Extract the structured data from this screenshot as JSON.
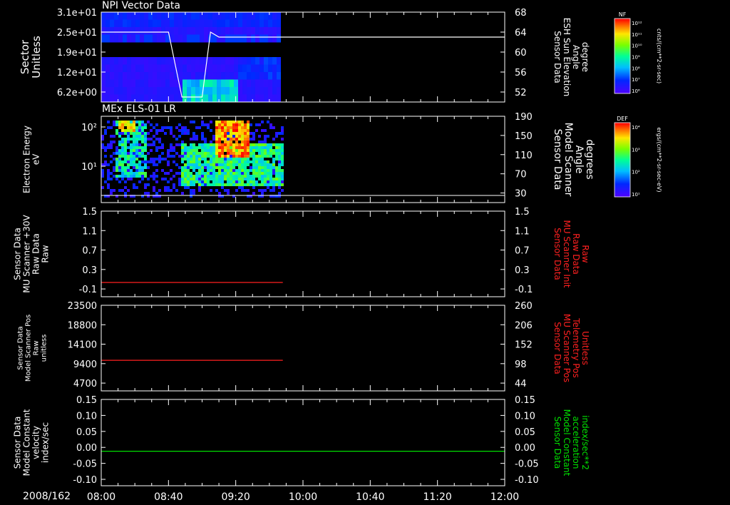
{
  "date_label": "2008/162",
  "time_ticks": [
    "08:00",
    "08:40",
    "09:20",
    "10:00",
    "10:40",
    "11:20",
    "12:00"
  ],
  "colors": {
    "red": "#ff2020",
    "green": "#00e000",
    "white": "#ffffff"
  },
  "chart_data": [
    {
      "type": "heatmap",
      "title": "NPI Vector Data",
      "left_axis": {
        "label_lines": [
          "Sector",
          "Unitless"
        ],
        "ticks": [
          "3.1e+01",
          "2.5e+01",
          "1.9e+01",
          "1.2e+01",
          "6.2e+00"
        ],
        "color": "#ffffff"
      },
      "right_axis": {
        "label_lines": [
          "Sensor Data",
          "ESH Sun Elevation",
          "Angle",
          "degree"
        ],
        "ticks": [
          "68",
          "64",
          "60",
          "56",
          "52"
        ],
        "color": "#ffffff"
      },
      "colorbar": {
        "title": "NF",
        "ticks": [
          "10¹²",
          "10¹¹",
          "10¹⁰",
          "10⁹",
          "10⁸",
          "10⁷",
          "10⁶"
        ],
        "label": "cnts/(cm**2-sr-sec)"
      },
      "data_extent": {
        "start": "08:00",
        "end": "09:45"
      },
      "line_series": {
        "name": "ESH Sun Elevation",
        "x": [
          "08:00",
          "08:40",
          "08:48",
          "09:00",
          "09:05",
          "09:10",
          "09:45",
          "12:00"
        ],
        "y": [
          64,
          64,
          51,
          51,
          64,
          63,
          63,
          63
        ]
      }
    },
    {
      "type": "heatmap",
      "title": "MEx ELS-01 LR",
      "left_axis": {
        "label_lines": [
          "Electron Energy",
          "eV"
        ],
        "ticks": [
          "10²",
          "10¹"
        ],
        "scale": "log",
        "color": "#ffffff"
      },
      "right_axis": {
        "label_lines": [
          "Sensor Data",
          "Model Scanner",
          "Angle",
          "degrees"
        ],
        "ticks": [
          "190",
          "150",
          "110",
          "70",
          "30"
        ],
        "color": "#ffffff"
      },
      "colorbar": {
        "title": "DEF",
        "ticks": [
          "10⁴",
          "10³",
          "10²",
          "10¹"
        ],
        "label": "ergs/(cm**2-sr-sec-eV)"
      },
      "data_extent": {
        "start": "08:00",
        "end": "09:47"
      },
      "line_series": {
        "name": "Model Scanner Angle",
        "value": 15
      }
    },
    {
      "type": "line",
      "left_axis": {
        "label_lines": [
          "Sensor Data",
          "MU Scanner +30V",
          "Raw Data",
          "Raw"
        ],
        "ticks": [
          "1.5",
          "1.1",
          "0.7",
          "0.3",
          "-0.1"
        ],
        "ylim": [
          -0.3,
          1.5
        ],
        "color": "#ffffff"
      },
      "right_axis": {
        "label_lines": [
          "Sensor Data",
          "MU Scanner Init",
          "Raw Data",
          "Raw"
        ],
        "ticks": [
          "1.5",
          "1.1",
          "0.7",
          "0.3",
          "-0.1"
        ],
        "color": "#ff2020"
      },
      "series": [
        {
          "x": [
            "08:00",
            "09:48"
          ],
          "y": [
            0,
            0
          ],
          "color": "#ff2020"
        }
      ]
    },
    {
      "type": "line",
      "left_axis": {
        "label_lines": [
          "Sensor Data",
          "Model Scanner Pos",
          "Raw",
          "unitless"
        ],
        "ticks": [
          "23500",
          "18800",
          "14100",
          "9400",
          "4700"
        ],
        "ylim": [
          0,
          23500
        ],
        "color": "#ffffff"
      },
      "right_axis": {
        "label_lines": [
          "Sensor Data",
          "MU Scanner Pos",
          "Telemetry Pos",
          "Unitless"
        ],
        "ticks": [
          "260",
          "206",
          "152",
          "98",
          "44"
        ],
        "color": "#ff2020"
      },
      "series": [
        {
          "x": [
            "08:00",
            "09:48"
          ],
          "y": [
            8400,
            8400
          ],
          "color": "#ff2020"
        }
      ]
    },
    {
      "type": "line",
      "left_axis": {
        "label_lines": [
          "Sensor Data",
          "Model Constant",
          "velocity",
          "index/sec"
        ],
        "ticks": [
          "0.15",
          "0.10",
          "0.05",
          "0.00",
          "-0.05",
          "-0.10"
        ],
        "ylim": [
          -0.1,
          0.15
        ],
        "color": "#ffffff"
      },
      "right_axis": {
        "label_lines": [
          "Sensor Data",
          "Model Constant",
          "acceleration",
          "index/sec**2"
        ],
        "ticks": [
          "0.15",
          "0.10",
          "0.05",
          "0.00",
          "-0.05",
          "-0.10"
        ],
        "color": "#00e000"
      },
      "series": [
        {
          "x": [
            "08:00",
            "12:00"
          ],
          "y": [
            0,
            0
          ],
          "color": "#00e000"
        }
      ]
    }
  ]
}
